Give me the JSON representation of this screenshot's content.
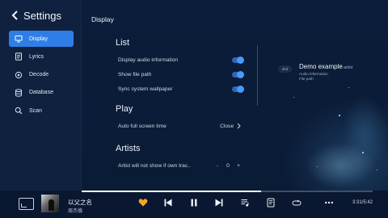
{
  "sidebar": {
    "title": "Settings",
    "items": [
      {
        "label": "Display",
        "icon": "monitor-icon",
        "active": true
      },
      {
        "label": "Lyrics",
        "icon": "lyrics-icon",
        "active": false
      },
      {
        "label": "Decode",
        "icon": "decode-icon",
        "active": false
      },
      {
        "label": "Database",
        "icon": "database-icon",
        "active": false
      },
      {
        "label": "Scan",
        "icon": "search-icon",
        "active": false
      }
    ]
  },
  "main": {
    "title": "Display",
    "sections": {
      "list": {
        "title": "List",
        "settings": [
          {
            "label": "Display audio information",
            "enabled": true
          },
          {
            "label": "Show file path",
            "enabled": true
          },
          {
            "label": "Sync system wallpaper",
            "enabled": true
          }
        ]
      },
      "play": {
        "title": "Play",
        "auto_full_screen_label": "Auto full screen time",
        "auto_full_screen_value": "Close"
      },
      "artists": {
        "title": "Artists",
        "hide_label": "Artist will not show if own trac..",
        "minus": "-",
        "value": "0",
        "plus": "+"
      }
    },
    "preview": {
      "badge": "dsd",
      "title": "Demo example",
      "artist": "-artist",
      "audio_info": "Audio information",
      "file_path": "File path"
    }
  },
  "player": {
    "song_title": "以父之名",
    "artist": "周杰倫",
    "time": "3:31/5:42",
    "progress": 0.617,
    "favorite_color": "#f5a623",
    "accent_color": "#2f7ee6",
    "icons": [
      "mini-player-icon",
      "heart-icon",
      "previous-icon",
      "pause-icon",
      "next-icon",
      "playlist-icon",
      "lyrics-icon",
      "repeat-icon",
      "more-icon"
    ]
  }
}
